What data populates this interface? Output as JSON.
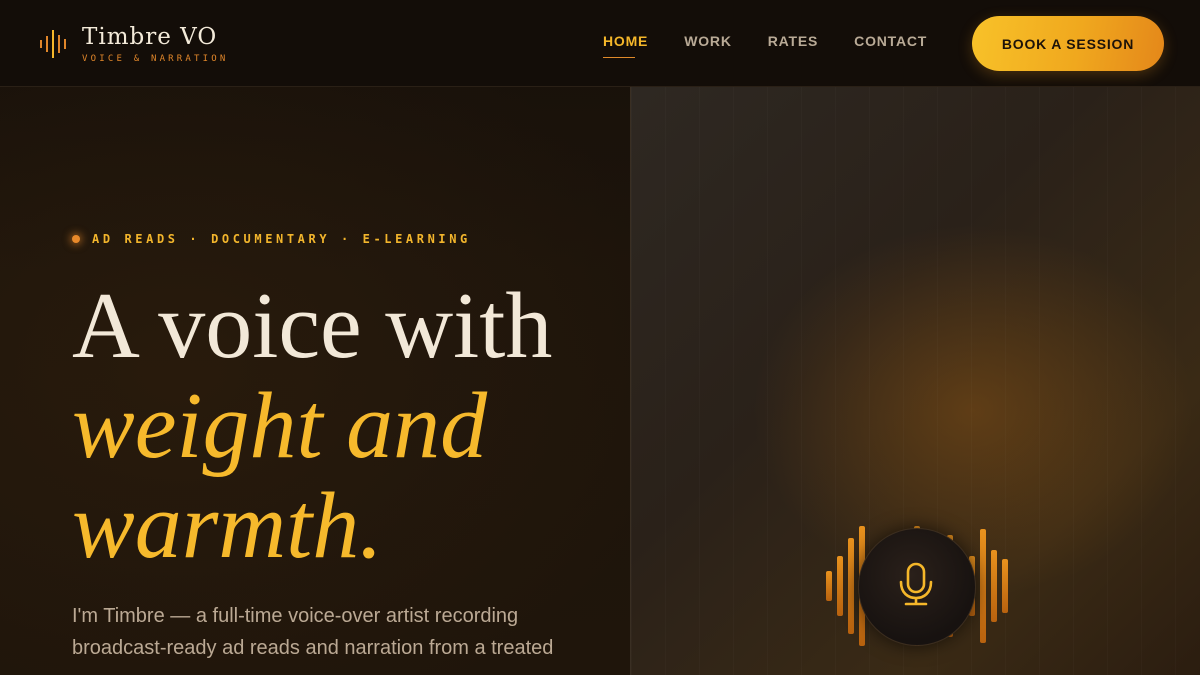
{
  "brand": {
    "name": "Timbre VO",
    "tagline": "VOICE & NARRATION",
    "accent_color": "#f5b72a",
    "secondary_color": "#e0862a"
  },
  "nav": {
    "items": [
      {
        "label": "HOME",
        "active": true
      },
      {
        "label": "WORK",
        "active": false
      },
      {
        "label": "RATES",
        "active": false
      },
      {
        "label": "CONTACT",
        "active": false
      }
    ],
    "cta_label": "BOOK A SESSION"
  },
  "hero": {
    "eyebrow": "AD READS · DOCUMENTARY · E-LEARNING",
    "headline_line1": "A voice with",
    "headline_line2": "weight and",
    "headline_line3": "warmth.",
    "subcopy": "I'm Timbre — a full-time voice-over artist recording broadcast-ready ad reads and narration from a treated"
  },
  "media": {
    "icon": "microphone-icon",
    "waveform_levels": [
      0.25,
      0.5,
      0.8,
      1.0,
      0.45,
      0.6,
      0.3,
      0.55,
      1.0,
      0.7,
      0.4,
      0.85,
      0.35,
      0.5,
      0.95,
      0.6,
      0.45
    ]
  }
}
